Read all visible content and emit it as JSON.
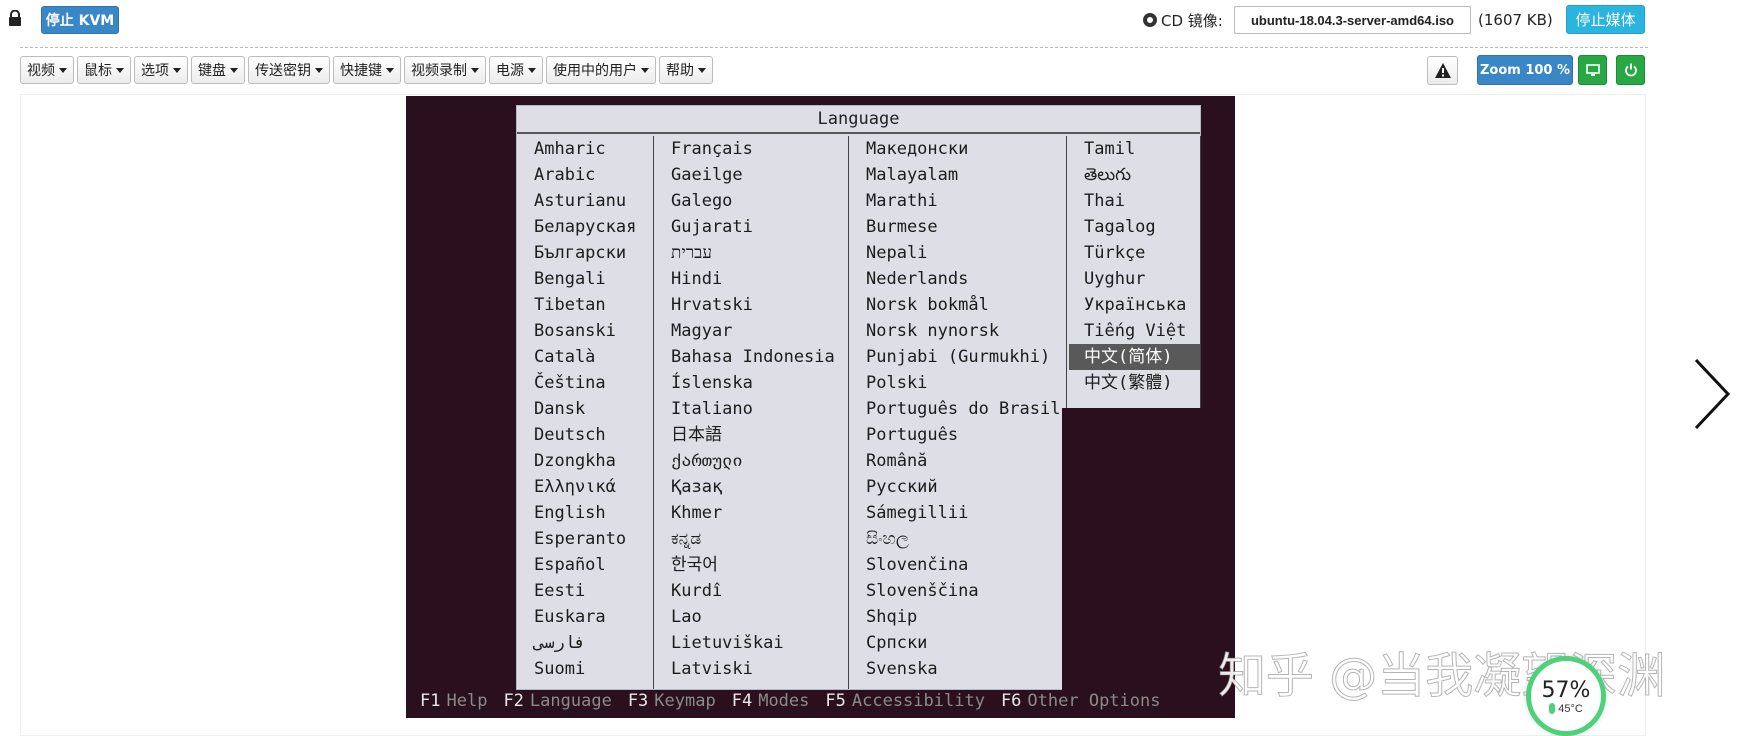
{
  "header": {
    "stop_kvm_label": "停止 KVM",
    "cd_label": "CD 镜像:",
    "iso_name": "ubuntu-18.04.3-server-amd64.iso",
    "iso_size": "(1607 KB)",
    "stop_media_label": "停止媒体"
  },
  "menu": {
    "items": [
      "视频",
      "鼠标",
      "选项",
      "键盘",
      "传送密钥",
      "快捷键",
      "视频录制",
      "电源",
      "使用中的用户",
      "帮助"
    ]
  },
  "toolbar": {
    "zoom_label": "Zoom 100 %"
  },
  "installer": {
    "title": "Language",
    "columns": [
      [
        "Amharic",
        "Arabic",
        "Asturianu",
        "Беларуская",
        "Български",
        "Bengali",
        "Tibetan",
        "Bosanski",
        "Català",
        "Čeština",
        "Dansk",
        "Deutsch",
        "Dzongkha",
        "Ελληνικά",
        "English",
        "Esperanto",
        "Español",
        "Eesti",
        "Euskara",
        "فارسی",
        "Suomi"
      ],
      [
        "Français",
        "Gaeilge",
        "Galego",
        "Gujarati",
        "עברית",
        "Hindi",
        "Hrvatski",
        "Magyar",
        "Bahasa Indonesia",
        "Íslenska",
        "Italiano",
        "日本語",
        "ქართული",
        "Қазақ",
        "Khmer",
        "ಕನ್ನಡ",
        "한국어",
        "Kurdî",
        "Lao",
        "Lietuviškai",
        "Latviski"
      ],
      [
        "Македонски",
        "Malayalam",
        "Marathi",
        "Burmese",
        "Nepali",
        "Nederlands",
        "Norsk bokmål",
        "Norsk nynorsk",
        "Punjabi (Gurmukhi)",
        "Polski",
        "Português do Brasil",
        "Português",
        "Română",
        "Русский",
        "Sámegillii",
        "සිංහල",
        "Slovenčina",
        "Slovenščina",
        "Shqip",
        "Српски",
        "Svenska"
      ],
      [
        "Tamil",
        "తెలుగు",
        "Thai",
        "Tagalog",
        "Türkçe",
        "Uyghur",
        "Українська",
        "Tiếng Việt",
        "中文(简体)",
        "中文(繁體)"
      ]
    ],
    "selected": "中文(简体)",
    "fkeys": [
      {
        "key": "F1",
        "label": "Help"
      },
      {
        "key": "F2",
        "label": "Language"
      },
      {
        "key": "F3",
        "label": "Keymap"
      },
      {
        "key": "F4",
        "label": "Modes"
      },
      {
        "key": "F5",
        "label": "Accessibility"
      },
      {
        "key": "F6",
        "label": "Other Options"
      }
    ]
  },
  "watermark": "知乎 @当我凝望深渊",
  "gauge": {
    "percent": "57%",
    "temp": "45°C",
    "color": "#4fd07a"
  },
  "icons": [
    "lock-icon",
    "disc-icon",
    "caret-down-icon",
    "warning-icon",
    "monitor-icon",
    "power-icon",
    "chevron-right-icon",
    "thermometer-icon"
  ]
}
